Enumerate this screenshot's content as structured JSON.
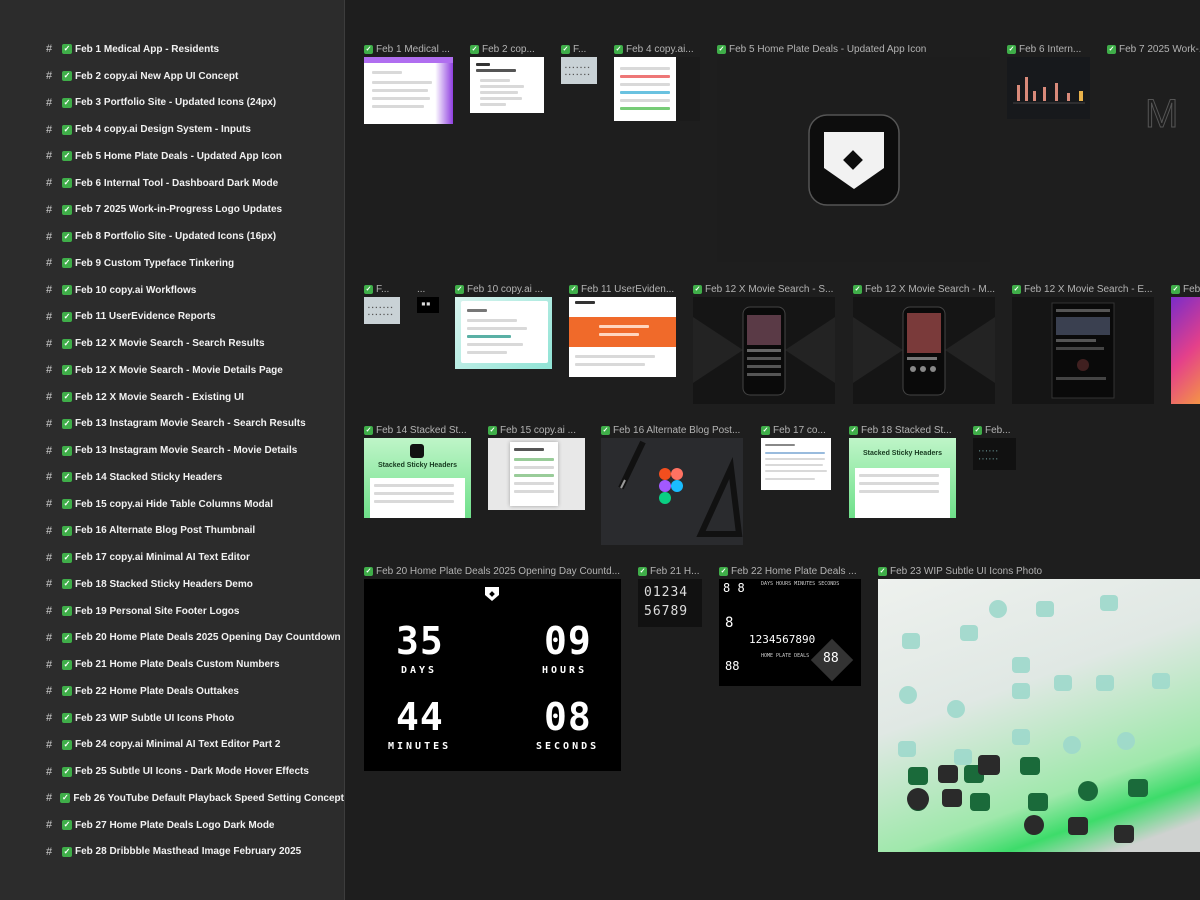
{
  "sidebar": {
    "items": [
      "Feb 1 Medical App - Residents",
      "Feb 2 copy.ai New App UI Concept",
      "Feb 3 Portfolio Site - Updated Icons (24px)",
      "Feb 4 copy.ai Design System - Inputs",
      "Feb 5 Home Plate Deals - Updated App Icon",
      "Feb 6 Internal Tool - Dashboard Dark Mode",
      "Feb 7 2025 Work-in-Progress Logo Updates",
      "Feb 8 Portfolio Site - Updated Icons (16px)",
      "Feb 9 Custom Typeface Tinkering",
      "Feb 10 copy.ai Workflows",
      "Feb 11 UserEvidence Reports",
      "Feb 12 X Movie Search - Search Results",
      "Feb 12 X Movie Search - Movie Details Page",
      "Feb 12 X Movie Search - Existing UI",
      "Feb 13 Instagram Movie Search - Search Results",
      "Feb 13 Instagram Movie Search - Movie Details",
      "Feb 14 Stacked Sticky Headers",
      "Feb 15 copy.ai Hide Table Columns Modal",
      "Feb 16 Alternate Blog Post Thumbnail",
      "Feb 17 copy.ai Minimal AI Text Editor",
      "Feb 18 Stacked Sticky Headers Demo",
      "Feb 19 Personal Site Footer Logos",
      "Feb 20 Home Plate Deals 2025 Opening Day Countdown",
      "Feb 21 Home Plate Deals Custom Numbers",
      "Feb 22 Home Plate Deals Outtakes",
      "Feb 23 WIP Subtle UI Icons Photo",
      "Feb 24 copy.ai Minimal AI Text Editor Part 2",
      "Feb 25 Subtle UI Icons - Dark Mode Hover Effects",
      "Feb 26 YouTube Default Playback Speed Setting Concept",
      "Feb 27 Home Plate Deals Logo Dark Mode",
      "Feb 28 Dribbble Masthead Image February 2025"
    ],
    "hash_icon": "#",
    "check_icon": "✓"
  },
  "frames": {
    "f1": "Feb 1 Medical ...",
    "f2": "Feb 2 cop...",
    "f3": "F...",
    "f4": "Feb 4 copy.ai...",
    "f5": "Feb 5 Home Plate Deals - Updated App Icon",
    "f6": "Feb 6 Intern...",
    "f7": "Feb 7 2025 Work-...",
    "f8": "F...",
    "f9": "...",
    "f10": "Feb 10 copy.ai ...",
    "f11": "Feb 11 UserEviden...",
    "f12a": "Feb 12 X Movie Search - S...",
    "f12b": "Feb 12 X Movie Search - M...",
    "f12c": "Feb 12 X Movie Search - E...",
    "f13": "Feb",
    "f14": "Feb 14 Stacked St...",
    "f15": "Feb 15 copy.ai ...",
    "f16": "Feb 16 Alternate Blog Post...",
    "f17": "Feb 17 co...",
    "f18": "Feb 18 Stacked St...",
    "f19": "Feb...",
    "f20": "Feb 20 Home Plate Deals 2025 Opening Day Countd...",
    "f21": "Feb 21 H...",
    "f22": "Feb 22 Home Plate Deals ...",
    "f23": "Feb 23 WIP Subtle UI Icons Photo"
  },
  "thumb_text": {
    "sticky_headers": "Stacked Sticky Headers",
    "countdown": {
      "days": "35",
      "days_label": "DAYS",
      "hours": "09",
      "hours_label": "HOURS",
      "minutes": "44",
      "minutes_label": "MINUTES",
      "seconds": "08",
      "seconds_label": "SECONDS"
    },
    "numbers_row1": "01234",
    "numbers_row2": "56789",
    "outtakes_digits": "1234567890",
    "outtakes_brand": "HOME PLATE DEALS"
  }
}
